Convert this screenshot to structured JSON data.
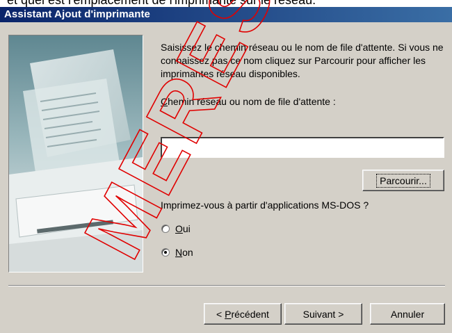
{
  "top_strip_text": "et quel est l'emplacement de l'imprimante sur le réseau.",
  "window": {
    "title": "Assistant Ajout d'imprimante"
  },
  "description": "Saisissez le chemin réseau ou le nom de file d'attente. Si vous ne connaissez pas ce nom cliquez sur Parcourir pour afficher les imprimantes réseau disponibles.",
  "path_label_prefix": "C",
  "path_label_rest": "hemin réseau ou nom de file d'attente :",
  "path_input_value": "",
  "browse_label": "Parcourir...",
  "msdos_question": "Imprimez-vous à partir d'applications MS-DOS ?",
  "radio_oui_mnemonic": "O",
  "radio_oui_rest": "ui",
  "radio_non_mnemonic": "N",
  "radio_non_rest": "on",
  "radio_selected": "Non",
  "buttons": {
    "prev_prefix": "< ",
    "prev_mnemonic": "P",
    "prev_rest": "récédent",
    "next": "Suivant >",
    "cancel": "Annuler"
  },
  "watermark_text": "MERES",
  "colors": {
    "title_start": "#0a246a",
    "title_end": "#3a6ea5",
    "dialog_bg": "#d4d0c8",
    "watermark": "#e00000"
  }
}
